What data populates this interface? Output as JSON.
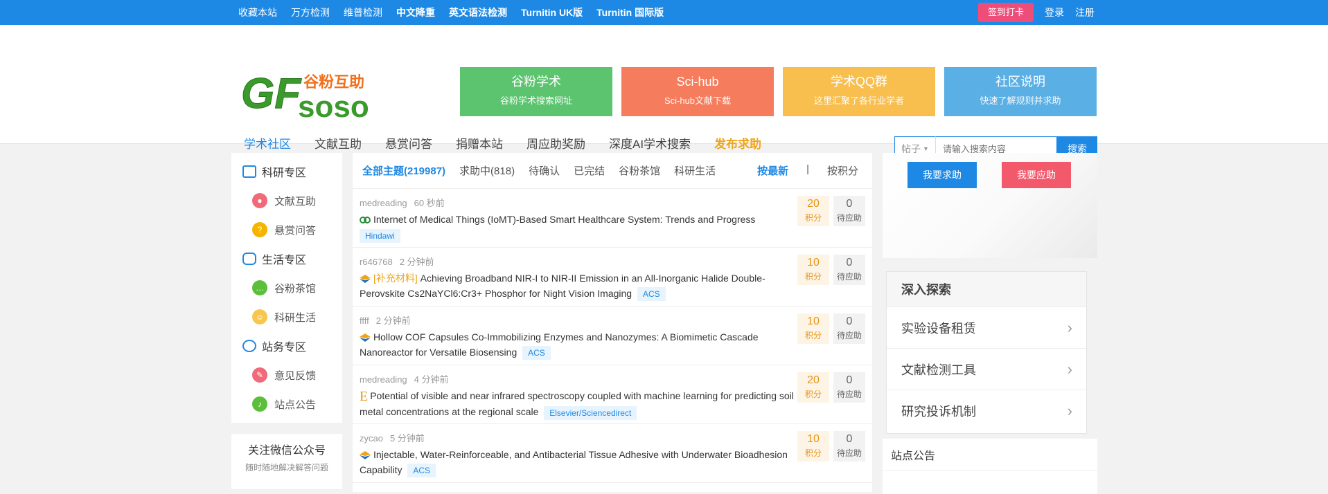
{
  "topbar": {
    "links": [
      "收藏本站",
      "万方检测",
      "维普检测",
      "中文降重",
      "英文语法检测",
      "Turnitin UK版",
      "Turnitin 国际版"
    ],
    "signin": "签到打卡",
    "login": "登录",
    "register": "注册"
  },
  "logo": {
    "text_cn": "谷粉互助",
    "text_main": "GF",
    "text_sub": "soso"
  },
  "cards": [
    {
      "title": "谷粉学术",
      "sub": "谷粉学术搜索网址",
      "color": "#5cc36f"
    },
    {
      "title": "Sci-hub",
      "sub": "Sci-hub文献下载",
      "color": "#f57c5d"
    },
    {
      "title": "学术QQ群",
      "sub": "这里汇聚了各行业学者",
      "color": "#f8bf4f"
    },
    {
      "title": "社区说明",
      "sub": "快速了解规则并求助",
      "color": "#5aafe4"
    }
  ],
  "nav": [
    "学术社区",
    "文献互助",
    "悬赏问答",
    "捐赠本站",
    "周应助奖励",
    "深度AI学术搜索",
    "发布求助"
  ],
  "search": {
    "type": "帖子",
    "placeholder": "请输入搜索内容",
    "button": "搜索"
  },
  "sidebar": {
    "sections": [
      {
        "title": "科研专区",
        "items": [
          {
            "label": "文献互助",
            "color": "#f06a7a"
          },
          {
            "label": "悬赏问答",
            "color": "#f5b400"
          }
        ]
      },
      {
        "title": "生活专区",
        "items": [
          {
            "label": "谷粉茶馆",
            "color": "#5bbf3a"
          },
          {
            "label": "科研生活",
            "color": "#f8c64f"
          }
        ]
      },
      {
        "title": "站务专区",
        "items": [
          {
            "label": "意见反馈",
            "color": "#f06a7a"
          },
          {
            "label": "站点公告",
            "color": "#5bbf3a"
          }
        ]
      }
    ],
    "wechat_title": "关注微信公众号",
    "wechat_sub": "随时随地解决解答问题"
  },
  "tabs": {
    "items": [
      "全部主题(219987)",
      "求助中(818)",
      "待确认",
      "已完结",
      "谷粉茶馆",
      "科研生活"
    ],
    "sort_latest": "按最新",
    "sort_sep": "|",
    "sort_points": "按积分"
  },
  "posts": [
    {
      "user": "medreading",
      "time": "60 秒前",
      "prefix": "",
      "title": "Internet of Medical Things (IoMT)-Based Smart Healthcare System: Trends and Progress",
      "tag": "Hindawi",
      "points": "20",
      "answers": "0",
      "icon": "hindawi-icon"
    },
    {
      "user": "r646768",
      "time": "2 分钟前",
      "prefix": "[补充材料]",
      "title": "Achieving Broadband NIR-I to NIR-II Emission in an All-Inorganic Halide Double-Perovskite Cs2NaYCl6:Cr3+ Phosphor for Night Vision Imaging",
      "tag": "ACS",
      "points": "10",
      "answers": "0",
      "icon": "acs-icon"
    },
    {
      "user": "ffff",
      "time": "2 分钟前",
      "prefix": "",
      "title": "Hollow COF Capsules Co-Immobilizing Enzymes and Nanozymes: A Biomimetic Cascade Nanoreactor for Versatile Biosensing",
      "tag": "ACS",
      "points": "10",
      "answers": "0",
      "icon": "acs-icon"
    },
    {
      "user": "medreading",
      "time": "4 分钟前",
      "prefix": "",
      "title": "Potential of visible and near infrared spectroscopy coupled with machine learning for predicting soil metal concentrations at the regional scale",
      "tag": "Elsevier/Sciencedirect",
      "points": "20",
      "answers": "0",
      "icon": "elsevier-icon"
    },
    {
      "user": "zycao",
      "time": "5 分钟前",
      "prefix": "",
      "title": "Injectable, Water-Reinforceable, and Antibacterial Tissue Adhesive with Underwater Bioadhesion Capability",
      "tag": "ACS",
      "points": "10",
      "answers": "0",
      "icon": "acs-icon"
    }
  ],
  "labels": {
    "points": "积分",
    "answers": "待应助"
  },
  "help": {
    "ask": "我要求助",
    "respond": "我要应助"
  },
  "explore": {
    "title": "深入探索",
    "items": [
      "实验设备租赁",
      "文献检测工具",
      "研究投诉机制"
    ]
  },
  "notice": {
    "title": "站点公告"
  }
}
